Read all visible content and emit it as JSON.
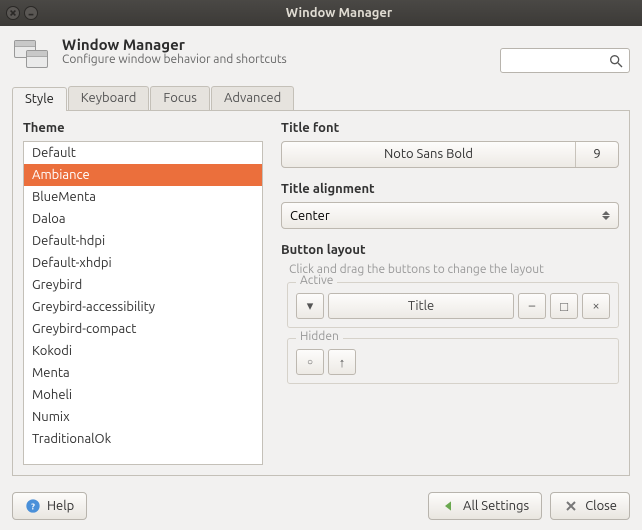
{
  "window": {
    "title": "Window Manager"
  },
  "header": {
    "title": "Window Manager",
    "subtitle": "Configure window behavior and shortcuts"
  },
  "tabs": [
    "Style",
    "Keyboard",
    "Focus",
    "Advanced"
  ],
  "active_tab": 0,
  "theme": {
    "label": "Theme",
    "items": [
      "Default",
      "Ambiance",
      "BlueMenta",
      "Daloa",
      "Default-hdpi",
      "Default-xhdpi",
      "Greybird",
      "Greybird-accessibility",
      "Greybird-compact",
      "Kokodi",
      "Menta",
      "Moheli",
      "Numix",
      "TraditionalOk"
    ],
    "selected": 1
  },
  "title_font": {
    "label": "Title font",
    "name": "Noto Sans Bold",
    "size": "9"
  },
  "title_align": {
    "label": "Title alignment",
    "value": "Center"
  },
  "button_layout": {
    "label": "Button layout",
    "hint": "Click and drag the buttons to change the layout",
    "active_label": "Active",
    "hidden_label": "Hidden",
    "title_btn": "Title"
  },
  "buttons": {
    "help": "Help",
    "all_settings": "All Settings",
    "close": "Close"
  }
}
